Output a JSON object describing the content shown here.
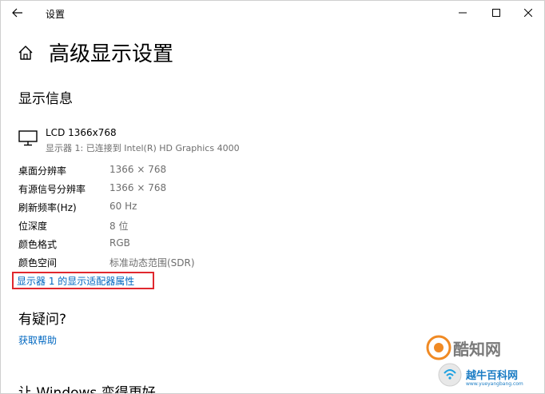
{
  "window": {
    "title": "设置",
    "controls": {
      "minimize_icon": "minimize-icon",
      "maximize_icon": "maximize-icon",
      "close_icon": "close-icon"
    }
  },
  "header": {
    "title": "高级显示设置"
  },
  "display_info": {
    "section_title": "显示信息",
    "monitor_name": "LCD 1366x768",
    "monitor_sub": "显示器 1: 已连接到 Intel(R) HD Graphics 4000",
    "rows": [
      {
        "label": "桌面分辨率",
        "value": "1366 × 768"
      },
      {
        "label": "有源信号分辨率",
        "value": "1366 × 768"
      },
      {
        "label": "刷新频率(Hz)",
        "value": "60 Hz"
      },
      {
        "label": "位深度",
        "value": "8 位"
      },
      {
        "label": "颜色格式",
        "value": "RGB"
      },
      {
        "label": "颜色空间",
        "value": "标准动态范围(SDR)"
      }
    ],
    "adapter_link": "显示器 1 的显示适配器属性"
  },
  "help": {
    "section_title": "有疑问?",
    "link": "获取帮助"
  },
  "feedback": {
    "section_title": "让 Windows 变得更好"
  },
  "watermark": {
    "brand": "酷知网",
    "slogan": "越牛百科网",
    "url": "www.yueyangbang.com"
  },
  "colors": {
    "link": "#0067c0",
    "highlight_border": "#e0282e",
    "secondary_text": "#6e6e6e"
  }
}
